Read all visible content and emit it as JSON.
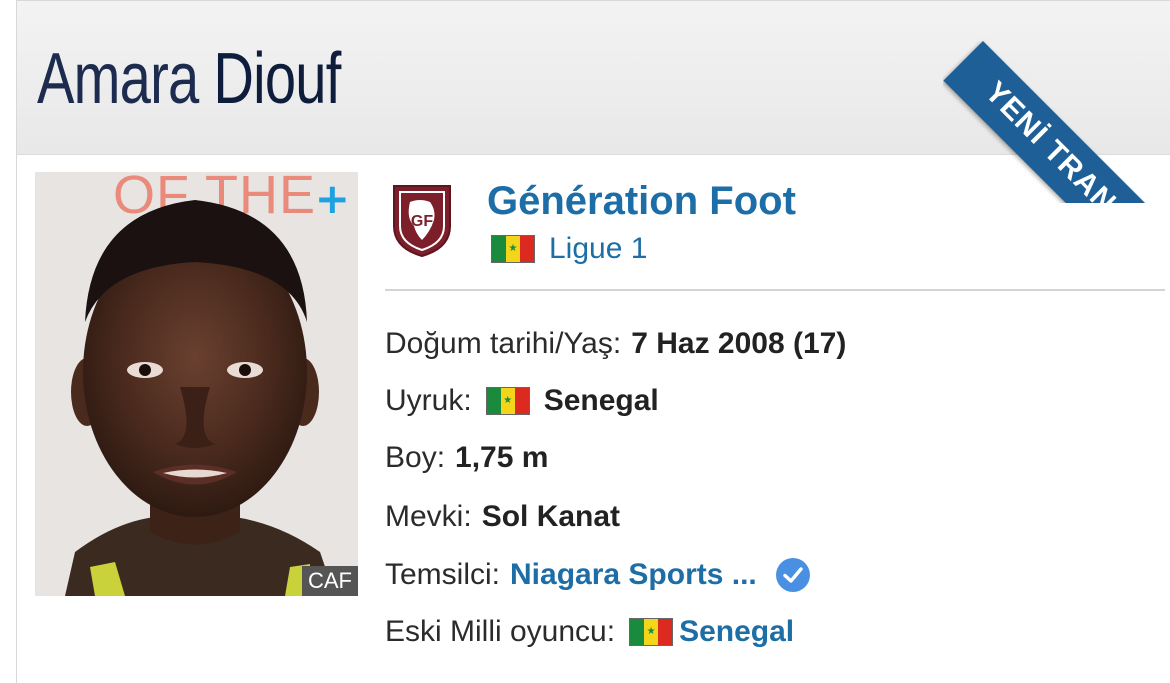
{
  "player": {
    "first_name": "Amara",
    "last_name": "Diouf"
  },
  "ribbon": {
    "text": "YENİ TRANSFER"
  },
  "photo": {
    "credit": "CAF",
    "plus_symbol": "+",
    "background_text": "OF THE"
  },
  "club": {
    "name": "Génération Foot",
    "league": "Ligue 1",
    "logo_initials": "GF",
    "league_flag_icon": "senegal-flag-icon"
  },
  "info": {
    "dob_label": "Doğum tarihi/Yaş:",
    "dob_value": "7 Haz 2008 (17)",
    "nationality_label": "Uyruk:",
    "nationality_value": "Senegal",
    "height_label": "Boy:",
    "height_value": "1,75 m",
    "position_label": "Mevki:",
    "position_value": "Sol Kanat",
    "agent_label": "Temsilci:",
    "agent_value": "Niagara Sports ...",
    "former_international_label": "Eski Milli oyuncu:",
    "former_international_value": "Senegal"
  },
  "colors": {
    "name_text": "#1d2b4f",
    "link_blue": "#1d6ea6",
    "ribbon_blue": "#1d5f96",
    "verified_blue": "#4a90e2",
    "club_maroon": "#7d1f2a",
    "flag_green": "#1a8b3c",
    "flag_yellow": "#f3d51a",
    "flag_red": "#dd2a21"
  }
}
